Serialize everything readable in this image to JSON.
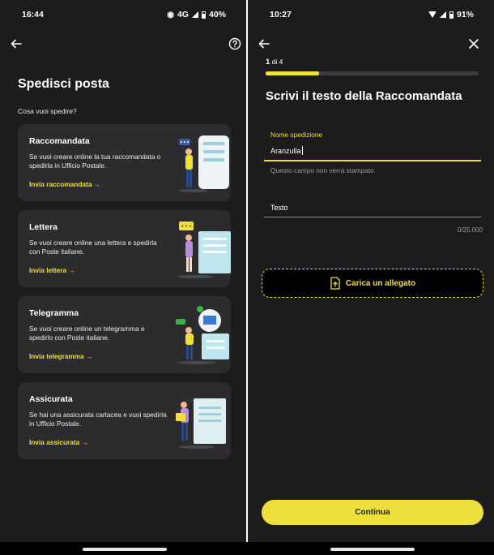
{
  "left_screen": {
    "status": {
      "time": "16:44",
      "network": "4G",
      "battery": "40%"
    },
    "title": "Spedisci posta",
    "subtitle": "Cosa vuoi spedire?",
    "cards": [
      {
        "title": "Raccomandata",
        "description": "Se vuoi creare online la tua raccomandata o spedirla in Ufficio Postale.",
        "link": "Invia raccomandata →"
      },
      {
        "title": "Lettera",
        "description": "Se vuoi creare online una lettera e spedirla con Poste italiane.",
        "link": "Invia lettera →"
      },
      {
        "title": "Telegramma",
        "description": "Se vuoi creare online un telegramma e spedirlo con Poste italiane.",
        "link": "Invia telegramma →"
      },
      {
        "title": "Assicurata",
        "description": "Se hai una assicurata cartacea e vuoi spedirla in Ufficio Postale.",
        "link": "Invia assicurata →"
      }
    ]
  },
  "right_screen": {
    "status": {
      "time": "10:27",
      "battery": "91%"
    },
    "step_current": "1",
    "step_total": "di 4",
    "progress": 0.25,
    "title": "Scrivi il testo della Raccomandata",
    "name_field": {
      "label": "Nome spedizione",
      "value": "Aranzulla",
      "hint": "Questo campo non verrà stampato"
    },
    "text_field": {
      "label": "Testo",
      "counter": "0/25.000"
    },
    "attach_label": "Carica un allegato",
    "continue_label": "Continua"
  },
  "colors": {
    "accent": "#f2df3b",
    "background": "#1c1c1d",
    "card": "#2c2c2e"
  }
}
